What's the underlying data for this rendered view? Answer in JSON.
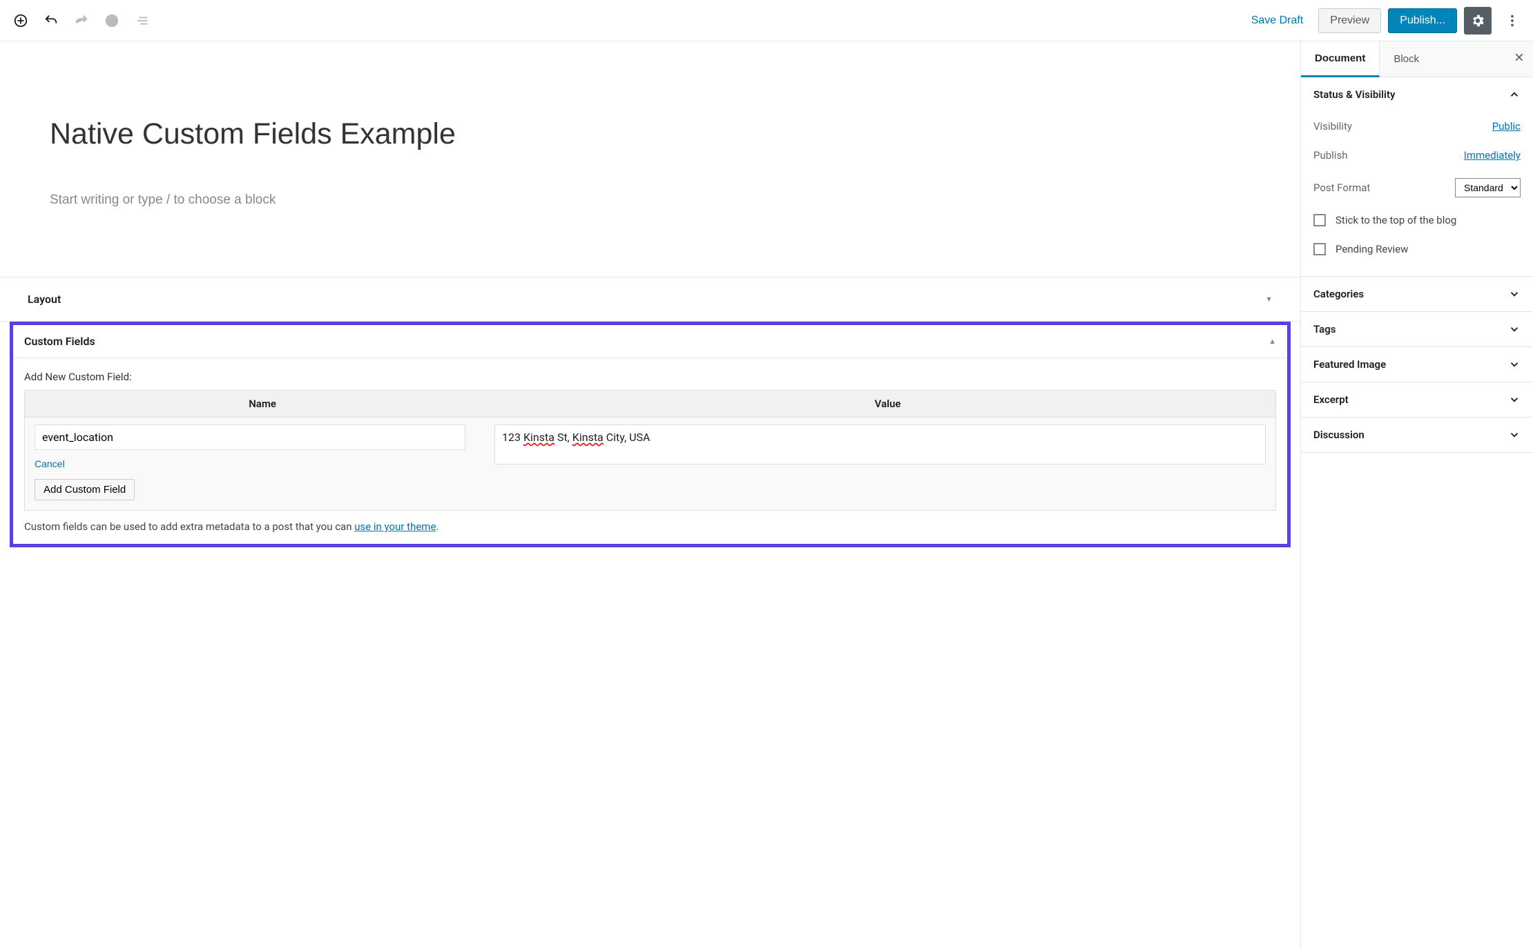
{
  "toolbar": {
    "save_draft": "Save Draft",
    "preview": "Preview",
    "publish": "Publish..."
  },
  "editor": {
    "title": "Native Custom Fields Example",
    "body_placeholder": "Start writing or type / to choose a block"
  },
  "metaboxes": {
    "layout_title": "Layout",
    "custom_fields": {
      "title": "Custom Fields",
      "add_new_label": "Add New Custom Field:",
      "th_name": "Name",
      "th_value": "Value",
      "name_value": "event_location",
      "value_value_prefix": "123 ",
      "value_value_w1": "Kinsta",
      "value_value_mid": " St, ",
      "value_value_w2": "Kinsta",
      "value_value_suffix": " City, USA",
      "cancel": "Cancel",
      "add_btn": "Add Custom Field",
      "help_text": "Custom fields can be used to add extra metadata to a post that you can ",
      "help_link": "use in your theme",
      "help_period": "."
    }
  },
  "sidebar": {
    "tabs": {
      "document": "Document",
      "block": "Block"
    },
    "status": {
      "title": "Status & Visibility",
      "visibility_label": "Visibility",
      "visibility_value": "Public",
      "publish_label": "Publish",
      "publish_value": "Immediately",
      "post_format_label": "Post Format",
      "post_format_value": "Standard",
      "stick_label": "Stick to the top of the blog",
      "pending_label": "Pending Review"
    },
    "panels": {
      "categories": "Categories",
      "tags": "Tags",
      "featured_image": "Featured Image",
      "excerpt": "Excerpt",
      "discussion": "Discussion"
    }
  }
}
